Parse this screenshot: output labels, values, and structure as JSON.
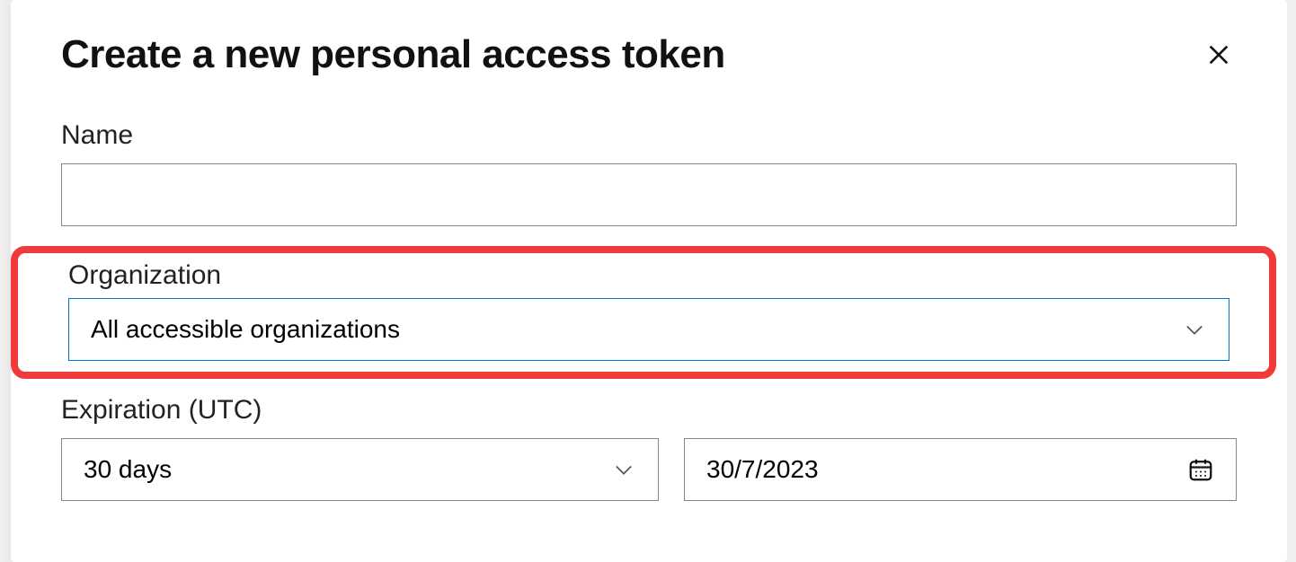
{
  "dialog": {
    "title": "Create a new personal access token"
  },
  "fields": {
    "name": {
      "label": "Name",
      "value": ""
    },
    "organization": {
      "label": "Organization",
      "selected": "All accessible organizations"
    },
    "expiration": {
      "label": "Expiration (UTC)",
      "duration_selected": "30 days",
      "date_value": "30/7/2023"
    }
  },
  "highlight": {
    "target": "organization-field",
    "color": "#ef3b3b"
  }
}
